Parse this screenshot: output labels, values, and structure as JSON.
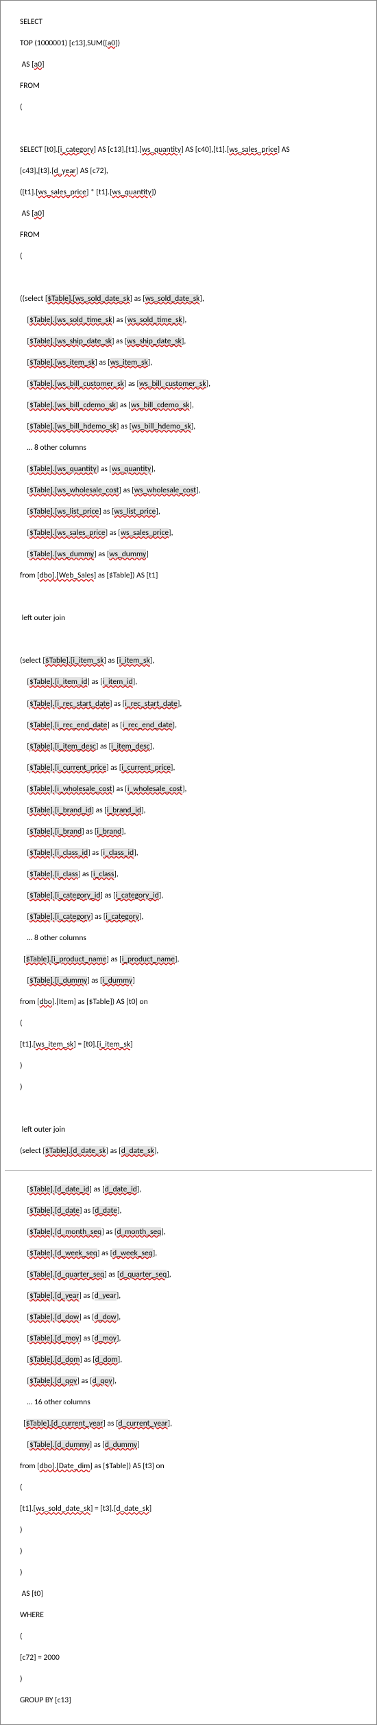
{
  "sql": {
    "l1": "SELECT",
    "l2_a": "TOP (1000001) [c13],SUM([",
    "l2_b": "a0",
    "l2_c": "])",
    "l3_a": " AS [",
    "l3_b": "a0",
    "l3_c": "]",
    "l4": "FROM",
    "l5": "(",
    "l6": "",
    "l7_a": "SELECT [t0].[",
    "l7_b": "i_category",
    "l7_c": "] AS [c13],[t1].[",
    "l7_d": "ws_quantity",
    "l7_e": "] AS [c40],[t1].[",
    "l7_f": "ws_sales_price",
    "l7_g": "] AS",
    "l8_a": "[c43],[t3].[",
    "l8_b": "d_year",
    "l8_c": "] AS [c72],",
    "l9_a": "([t1].[",
    "l9_b": "ws_sales_price",
    "l9_c": "] * [t1].[",
    "l9_d": "ws_quantity",
    "l9_e": "])",
    "l10_a": " AS [",
    "l10_b": "a0",
    "l10_c": "]",
    "l11": "FROM",
    "l12": "(",
    "l13": "",
    "l14_a": "((select [",
    "l14_b": "$Table].[ws_sold_date_sk",
    "l14_c": "] as [",
    "l14_d": "ws_sold_date_sk",
    "l14_e": "],",
    "l15_a": "    [",
    "l15_b": "$Table].[ws_sold_time_sk",
    "l15_c": "] as [",
    "l15_d": "ws_sold_time_sk",
    "l15_e": "],",
    "l16_a": "    [",
    "l16_b": "$Table].[ws_ship_date_sk",
    "l16_c": "] as [",
    "l16_d": "ws_ship_date_sk",
    "l16_e": "],",
    "l17_a": "    [",
    "l17_b": "$Table].[ws_item_sk",
    "l17_c": "] as [",
    "l17_d": "ws_item_sk",
    "l17_e": "],",
    "l18_a": "    [",
    "l18_b": "$Table].[ws_bill_customer_sk",
    "l18_c": "] as [",
    "l18_d": "ws_bill_customer_sk",
    "l18_e": "],",
    "l19_a": "    [",
    "l19_b": "$Table].[ws_bill_cdemo_sk",
    "l19_c": "] as [",
    "l19_d": "ws_bill_cdemo_sk",
    "l19_e": "],",
    "l20_a": "    [",
    "l20_b": "$Table].[ws_bill_hdemo_sk",
    "l20_c": "] as [",
    "l20_d": "ws_bill_hdemo_sk",
    "l20_e": "],",
    "l21": "    … 8 other columns",
    "l22_a": "    [",
    "l22_b": "$Table].[ws_quantity",
    "l22_c": "] as [",
    "l22_d": "ws_quantity",
    "l22_e": "],",
    "l23_a": "    [",
    "l23_b": "$Table].[ws_wholesale_cost",
    "l23_c": "] as [",
    "l23_d": "ws_wholesale_cost",
    "l23_e": "],",
    "l24_a": "    [",
    "l24_b": "$Table].[ws_list_price",
    "l24_c": "] as [",
    "l24_d": "ws_list_price",
    "l24_e": "],",
    "l25_a": "    [",
    "l25_b": "$Table].[ws_sales_price",
    "l25_c": "] as [",
    "l25_d": "ws_sales_price",
    "l25_e": "],",
    "l26_a": "    [",
    "l26_b": "$Table].[ws_dummy",
    "l26_c": "] as [",
    "l26_d": "ws_dummy",
    "l26_e": "]",
    "l27_a": "from [",
    "l27_b": "dbo].[Web_Sales",
    "l27_c": "] as [$Table]) AS [t1]",
    "l28": "",
    "l29": " left outer join",
    "l30": "",
    "l31_a": "(select [",
    "l31_b": "$Table].[i_item_sk",
    "l31_c": "] as [",
    "l31_d": "i_item_sk",
    "l31_e": "],",
    "l32_a": "    [",
    "l32_b": "$Table].[i_item_id",
    "l32_c": "] as [",
    "l32_d": "i_item_id",
    "l32_e": "],",
    "l33_a": "    [",
    "l33_b": "$Table].[i_rec_start_date",
    "l33_c": "] as [",
    "l33_d": "i_rec_start_date",
    "l33_e": "],",
    "l34_a": "    [",
    "l34_b": "$Table].[i_rec_end_date",
    "l34_c": "] as [",
    "l34_d": "i_rec_end_date",
    "l34_e": "],",
    "l35_a": "    [",
    "l35_b": "$Table].[i_item_desc",
    "l35_c": "] as [",
    "l35_d": "i_item_desc",
    "l35_e": "],",
    "l36_a": "    [",
    "l36_b": "$Table].[i_current_price",
    "l36_c": "] as [",
    "l36_d": "i_current_price",
    "l36_e": "],",
    "l37_a": "    [",
    "l37_b": "$Table].[i_wholesale_cost",
    "l37_c": "] as [",
    "l37_d": "i_wholesale_cost",
    "l37_e": "],",
    "l38_a": "    [",
    "l38_b": "$Table].[i_brand_id",
    "l38_c": "] as [",
    "l38_d": "i_brand_id",
    "l38_e": "],",
    "l39_a": "    [",
    "l39_b": "$Table].[i_brand",
    "l39_c": "] as [",
    "l39_d": "i_brand",
    "l39_e": "],",
    "l40_a": "    [",
    "l40_b": "$Table].[i_class_id",
    "l40_c": "] as [",
    "l40_d": "i_class_id",
    "l40_e": "],",
    "l41_a": "    [",
    "l41_b": "$Table].[i_class",
    "l41_c": "] as [",
    "l41_d": "i_class",
    "l41_e": "],",
    "l42_a": "    [",
    "l42_b": "$Table].[i_category_id",
    "l42_c": "] as [",
    "l42_d": "i_category_id",
    "l42_e": "],",
    "l43_a": "    [",
    "l43_b": "$Table].[i_category",
    "l43_c": "] as [",
    "l43_d": "i_category",
    "l43_e": "],",
    "l44": "    … 8 other columns",
    "l45_a": "  [",
    "l45_b": "$Table].[i_product_name",
    "l45_c": "] as [",
    "l45_d": "i_product_name",
    "l45_e": "],",
    "l46_a": "    [",
    "l46_b": "$Table].[i_dummy",
    "l46_c": "] as [",
    "l46_d": "i_dummy",
    "l46_e": "]",
    "l47_a": "from [",
    "l47_b": "dbo",
    "l47_c": "].[Item] as [$Table]) AS [t0] on",
    "l48": "(",
    "l49_a": "[t1].[",
    "l49_b": "ws_item_sk",
    "l49_c": "] = [t0].[",
    "l49_d": "i_item_sk",
    "l49_e": "]",
    "l50": ")",
    "l51": ")",
    "l52": "",
    "l53": " left outer join",
    "l54_a": "(select [",
    "l54_b": "$Table].[d_date_sk",
    "l54_c": "] as [",
    "l54_d": "d_date_sk",
    "l54_e": "],",
    "l55_a": "    [",
    "l55_b": "$Table].[d_date_id",
    "l55_c": "] as [",
    "l55_d": "d_date_id",
    "l55_e": "],",
    "l56_a": "    [",
    "l56_b": "$Table].[d_date",
    "l56_c": "] as [",
    "l56_d": "d_date",
    "l56_e": "],",
    "l57_a": "    [",
    "l57_b": "$Table].[d_month_seq",
    "l57_c": "] as [",
    "l57_d": "d_month_seq",
    "l57_e": "],",
    "l58_a": "    [",
    "l58_b": "$Table].[d_week_seq",
    "l58_c": "] as [",
    "l58_d": "d_week_seq",
    "l58_e": "],",
    "l59_a": "    [",
    "l59_b": "$Table].[d_quarter_seq",
    "l59_c": "] as [",
    "l59_d": "d_quarter_seq",
    "l59_e": "],",
    "l60_a": "    [",
    "l60_b": "$Table].[d_year",
    "l60_c": "] as [",
    "l60_d": "d_year",
    "l60_e": "],",
    "l61_a": "    [",
    "l61_b": "$Table].[d_dow",
    "l61_c": "] as [",
    "l61_d": "d_dow",
    "l61_e": "],",
    "l62_a": "    [",
    "l62_b": "$Table].[d_moy",
    "l62_c": "] as [",
    "l62_d": "d_moy",
    "l62_e": "],",
    "l63_a": "    [",
    "l63_b": "$Table].[d_dom",
    "l63_c": "] as [",
    "l63_d": "d_dom",
    "l63_e": "],",
    "l64_a": "    [",
    "l64_b": "$Table].[d_qoy",
    "l64_c": "] as [",
    "l64_d": "d_qoy",
    "l64_e": "],",
    "l65": "    … 16 other columns",
    "l66_a": "  [",
    "l66_b": "$Table].[d_current_year",
    "l66_c": "] as [",
    "l66_d": "d_current_year",
    "l66_e": "],",
    "l67_a": "    [",
    "l67_b": "$Table].[d_dummy",
    "l67_c": "] as [",
    "l67_d": "d_dummy",
    "l67_e": "]",
    "l68_a": "from [",
    "l68_b": "dbo].[Date_dim",
    "l68_c": "] as [$Table]) AS [t3] on",
    "l69": "(",
    "l70_a": "[t1].[",
    "l70_b": "ws_sold_date_sk",
    "l70_c": "] = [t3].[",
    "l70_d": "d_date_sk",
    "l70_e": "]",
    "l71": ")",
    "l72": ")",
    "l73": ")",
    "l74": " AS [t0]",
    "l75": "WHERE",
    "l76": "(",
    "l77": "[c72] = 2000",
    "l78": ")",
    "l79": "GROUP BY [c13]"
  }
}
